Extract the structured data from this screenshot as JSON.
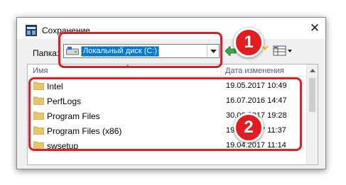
{
  "window": {
    "title": "Сохранение",
    "close_glyph": "✕"
  },
  "toolbar": {
    "folder_label": "Папка:",
    "location": "Локальный диск (C:)"
  },
  "list": {
    "columns": {
      "name": "Имя",
      "date": "Дата изменения"
    },
    "rows": [
      {
        "name": "Intel",
        "date": "19.05.2017 10:49"
      },
      {
        "name": "PerfLogs",
        "date": "16.07.2016 14:47"
      },
      {
        "name": "Program Files",
        "date": "30.06.2017 19:28"
      },
      {
        "name": "Program Files (x86)",
        "date": "19.06.2017 11:37"
      },
      {
        "name": "swsetup",
        "date": "19.04.2017 11:14"
      }
    ]
  },
  "annotations": {
    "badge1": "1",
    "badge2": "2"
  },
  "colors": {
    "highlight": "#e11d21",
    "selection": "#0078d7",
    "folder": "#e8c46a"
  },
  "icons": [
    "app-icon",
    "close-icon",
    "drive-icon",
    "dropdown-arrow-icon",
    "back-icon",
    "new-folder-icon",
    "view-menu-icon",
    "folder-icon",
    "sort-arrow-icon",
    "scroll-up-icon"
  ]
}
